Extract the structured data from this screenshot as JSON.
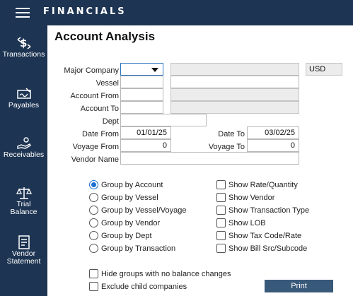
{
  "app": {
    "title": "FINANCIALS"
  },
  "sidebar": {
    "items": [
      {
        "label": "Transactions",
        "icon": "dollar-transfer-icon"
      },
      {
        "label": "Payables",
        "icon": "check-signature-icon"
      },
      {
        "label": "Receivables",
        "icon": "hand-coin-icon"
      },
      {
        "label": "Trial Balance",
        "icon": "balance-scale-icon"
      },
      {
        "label": "Vendor Statement",
        "icon": "statement-document-icon"
      }
    ]
  },
  "page": {
    "title": "Account Analysis"
  },
  "form": {
    "major_company": {
      "label": "Major Company",
      "value": "",
      "currency": "USD"
    },
    "vessel": {
      "label": "Vessel",
      "value": ""
    },
    "account_from": {
      "label": "Account From",
      "value": ""
    },
    "account_to": {
      "label": "Account To",
      "value": ""
    },
    "dept": {
      "label": "Dept",
      "value": ""
    },
    "date_from": {
      "label": "Date From",
      "value": "01/01/25"
    },
    "date_to": {
      "label": "Date To",
      "value": "03/02/25"
    },
    "voyage_from": {
      "label": "Voyage From",
      "value": "0"
    },
    "voyage_to": {
      "label": "Voyage To",
      "value": "0"
    },
    "vendor_name": {
      "label": "Vendor Name",
      "value": ""
    }
  },
  "grouping": {
    "selected": "Group by Account",
    "options": [
      "Group by Account",
      "Group by Vessel",
      "Group by Vessel/Voyage",
      "Group by Vendor",
      "Group by Dept",
      "Group by Transaction"
    ]
  },
  "show_options": [
    {
      "label": "Show Rate/Quantity",
      "checked": false
    },
    {
      "label": "Show Vendor",
      "checked": false
    },
    {
      "label": "Show Transaction Type",
      "checked": false
    },
    {
      "label": "Show LOB",
      "checked": false
    },
    {
      "label": "Show Tax Code/Rate",
      "checked": false
    },
    {
      "label": "Show Bill Src/Subcode",
      "checked": false
    }
  ],
  "extra_options": [
    {
      "label": "Hide groups with no balance changes",
      "checked": false
    },
    {
      "label": "Exclude child companies",
      "checked": false
    }
  ],
  "actions": {
    "print_label": "Print"
  },
  "colors": {
    "nav_bg": "#1d3452",
    "button_bg": "#38597a",
    "accent": "#1a6fd1"
  }
}
